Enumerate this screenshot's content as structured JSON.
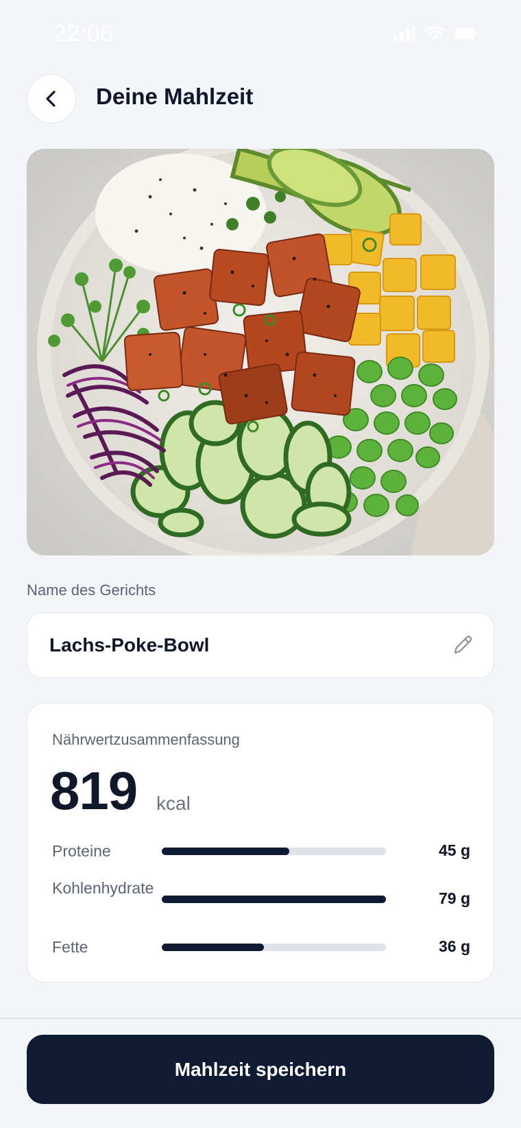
{
  "status_bar": {
    "time": "22:06"
  },
  "header": {
    "title": "Deine Mahlzeit"
  },
  "dish": {
    "label": "Name des Gerichts",
    "name": "Lachs-Poke-Bowl"
  },
  "nutrition": {
    "label": "Nährwertzusammenfassung",
    "calories": "819",
    "calories_unit": "kcal",
    "macros": [
      {
        "name": "Proteine",
        "value": "45 g",
        "fraction": 0.57
      },
      {
        "name": "Kohlenhydrate",
        "value": "79 g",
        "fraction": 1.0
      },
      {
        "name": "Fette",
        "value": "36 g",
        "fraction": 0.455
      }
    ]
  },
  "footer": {
    "save_label": "Mahlzeit speichern"
  },
  "colors": {
    "primary": "#0f1a33",
    "background": "#f3f5f8",
    "track": "#dfe3e9"
  }
}
